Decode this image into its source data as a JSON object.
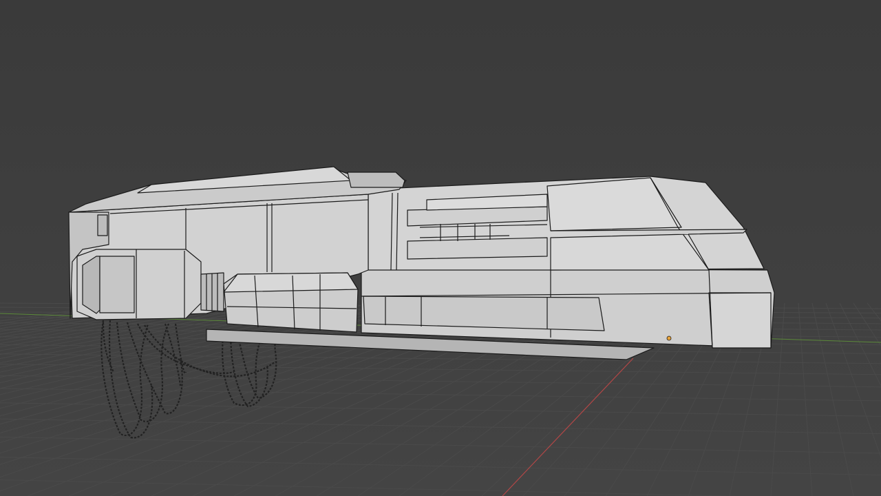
{
  "app": {
    "window": "3D Viewport",
    "shading_mode": "solid-wireframe"
  },
  "viewport": {
    "background_color": "#3d3d3d",
    "grid_color": "#4a4a4a",
    "x_axis_color": "#b34747",
    "y_axis_color": "#5c8a3a",
    "mesh_fill_color": "#c8c8c8",
    "mesh_edge_color": "#1a1a1a",
    "selected_origin_color": "#e8a33a"
  },
  "scene": {
    "object": "hover-vehicle-mesh",
    "has_cables": true,
    "has_object_origin": true
  }
}
